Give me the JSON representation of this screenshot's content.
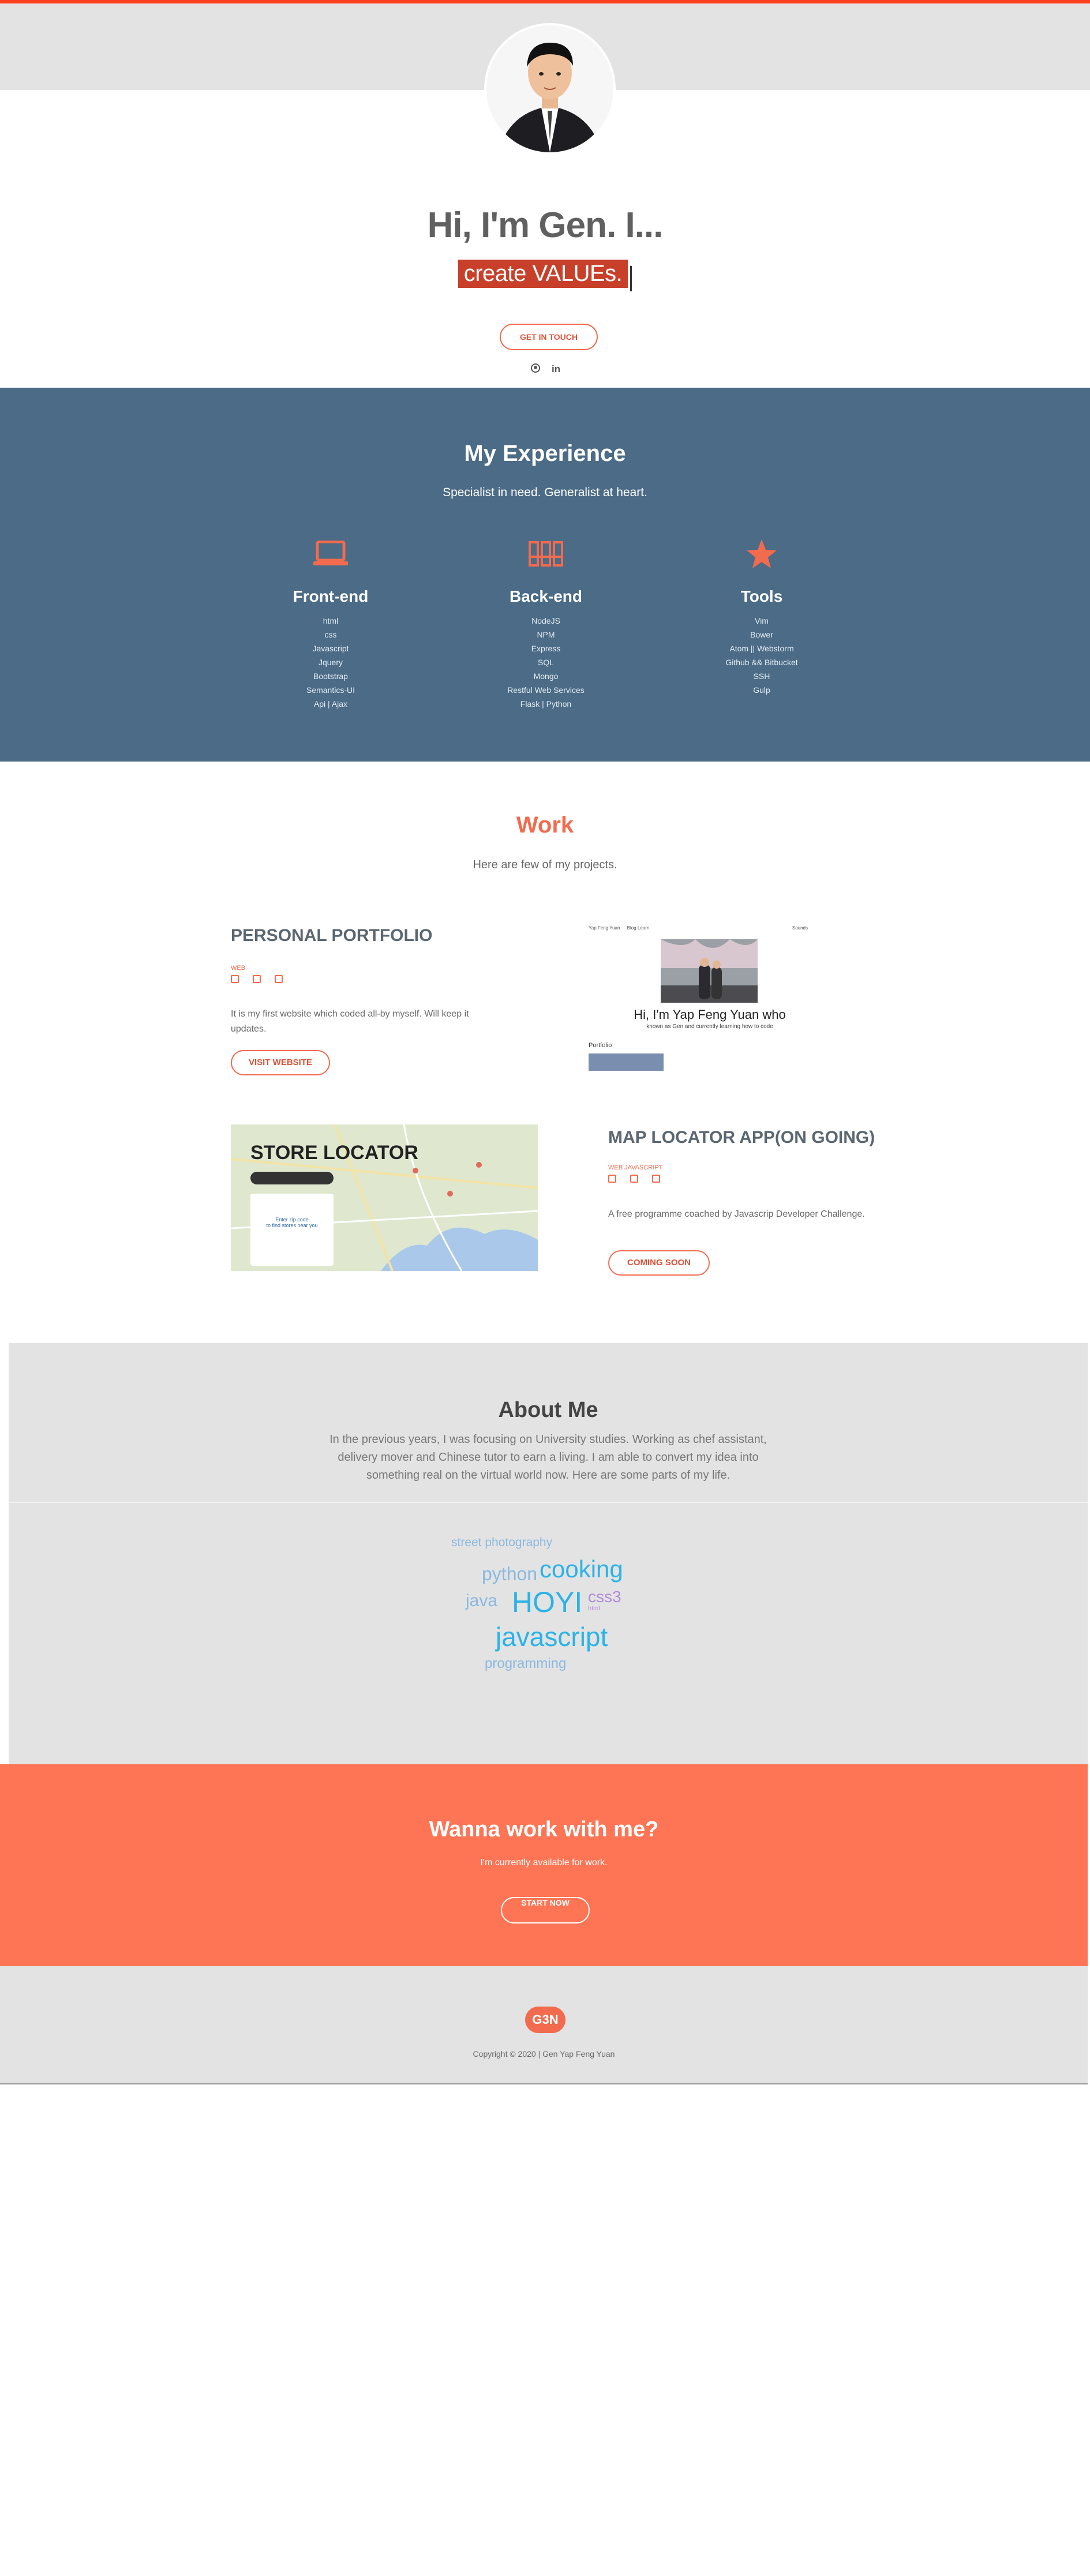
{
  "hero": {
    "title": "Hi, I'm Gen. I...",
    "typed_text": "create VALUEs.",
    "button_label": "GET IN TOUCH",
    "social_icons": [
      "github-icon",
      "linkedin-icon"
    ],
    "linkedin_glyph": "in"
  },
  "experience": {
    "title": "My Experience",
    "subtitle": "Specialist in need. Generalist at heart.",
    "accent_color": "#f26b4e",
    "columns": [
      {
        "icon": "laptop-icon",
        "title": "Front-end",
        "items": [
          "html",
          "css",
          "Javascript",
          "Jquery",
          "Bootstrap",
          "Semantics-UI",
          "Api | Ajax"
        ]
      },
      {
        "icon": "server-rack-icon",
        "title": "Back-end",
        "items": [
          "NodeJS",
          "NPM",
          "Express",
          "SQL",
          "Mongo",
          "Restful Web Services",
          "Flask | Python"
        ]
      },
      {
        "icon": "star-icon",
        "title": "Tools",
        "items": [
          "Vim",
          "Bower",
          "Atom || Webstorm",
          "Github && Bitbucket",
          "SSH",
          "Gulp"
        ]
      }
    ]
  },
  "work": {
    "title": "Work",
    "subtitle": "Here are few of my projects.",
    "projects": [
      {
        "title": "PERSONAL PORTFOLIO",
        "tag": "WEB",
        "description": "It is my first website which coded all-by myself. Will keep it updates.",
        "button": "VISIT WEBSITE",
        "preview": {
          "nav_brand": "Yap Feng Yuan",
          "nav_links": "Blog   Learn",
          "nav_right": "Sounds",
          "heading": "Hi, I'm Yap Feng Yuan who",
          "sub": "known as Gen and currently learning how to code",
          "section": "Portfolio"
        }
      },
      {
        "title": "MAP LOCATOR APP(ON GOING)",
        "tag": "WEB JAVASCRIPT",
        "description": "A free programme coached by Javascrip Developer Challenge.",
        "button": "COMING SOON",
        "preview": {
          "heading": "STORE LOCATOR",
          "card_line1": "Enter zip code",
          "card_line2": "to find stores near you"
        }
      }
    ]
  },
  "about": {
    "title": "About Me",
    "text": "In the previous years, I was focusing on University studies. Working as chef assistant, delivery mover and Chinese tutor to earn a living. I am able to convert my idea into something real on the virtual world now. Here are some parts of my life.",
    "cloud": [
      {
        "word": "street photography",
        "color": "#8ab9e0"
      },
      {
        "word": "python",
        "color": "#8ab9e0"
      },
      {
        "word": "cooking",
        "color": "#2bb3e6"
      },
      {
        "word": "java",
        "color": "#8ab9e0"
      },
      {
        "word": "HOYI",
        "color": "#2bb3e6"
      },
      {
        "word": "css3",
        "color": "#b08ad9"
      },
      {
        "word": "html",
        "color": "#b08ad9"
      },
      {
        "word": "javascript",
        "color": "#2bb3e6"
      },
      {
        "word": "programming",
        "color": "#8ab9e0"
      }
    ]
  },
  "cta": {
    "title": "Wanna work with me?",
    "subtitle": "I'm currently available for work.",
    "button": "START NOW"
  },
  "footer": {
    "logo": "G3N",
    "copyright": "Copyright © 2020 | Gen Yap Feng Yuan"
  }
}
